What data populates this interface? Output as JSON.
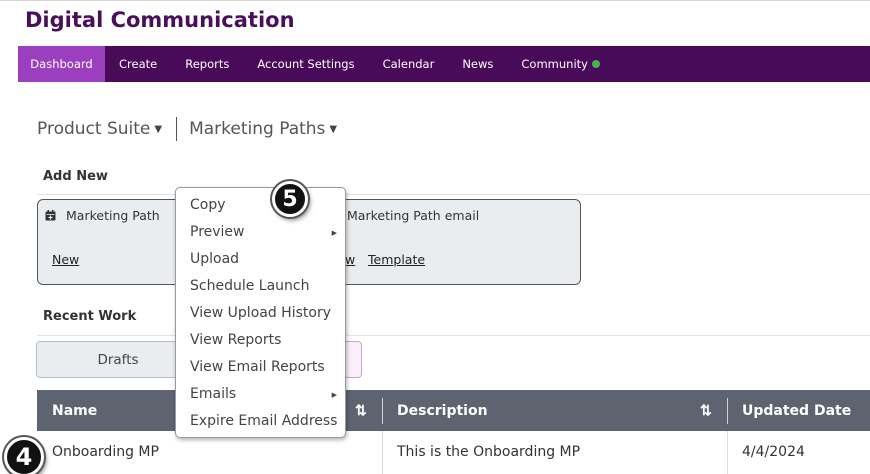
{
  "app": {
    "title": "Digital Communication"
  },
  "nav": {
    "items": [
      {
        "label": "Dashboard",
        "active": true
      },
      {
        "label": "Create"
      },
      {
        "label": "Reports"
      },
      {
        "label": "Account Settings"
      },
      {
        "label": "Calendar"
      },
      {
        "label": "News"
      },
      {
        "label": "Community",
        "status_dot_color": "#4caf50"
      }
    ]
  },
  "breadcrumbs": {
    "product": "Product Suite",
    "section": "Marketing Paths"
  },
  "add_new": {
    "heading": "Add New",
    "card_left": {
      "label": "Marketing Path",
      "icon": "calendar-plus-icon",
      "link": "New"
    },
    "card_right": {
      "label": "Marketing Path email",
      "link_partial": "w",
      "template_link": "Template"
    }
  },
  "recent_work": {
    "heading": "Recent Work",
    "tabs": {
      "drafts": "Drafts"
    },
    "table": {
      "columns": [
        "Name",
        "Description",
        "Updated Date"
      ],
      "rows": [
        {
          "name": "Onboarding MP",
          "description": "This is the Onboarding MP",
          "updated": "4/4/2024"
        }
      ]
    }
  },
  "context_menu": {
    "items": [
      "Copy",
      "Preview",
      "Upload",
      "Schedule Launch",
      "View Upload History",
      "View Reports",
      "View Email Reports",
      "Emails",
      "Expire Email Address"
    ]
  },
  "callouts": {
    "menu_step": "5",
    "row_step": "4"
  },
  "colors": {
    "brand_purple": "#4a0a5a",
    "active_tab": "#9b3fbe",
    "table_header": "#5d6470"
  }
}
